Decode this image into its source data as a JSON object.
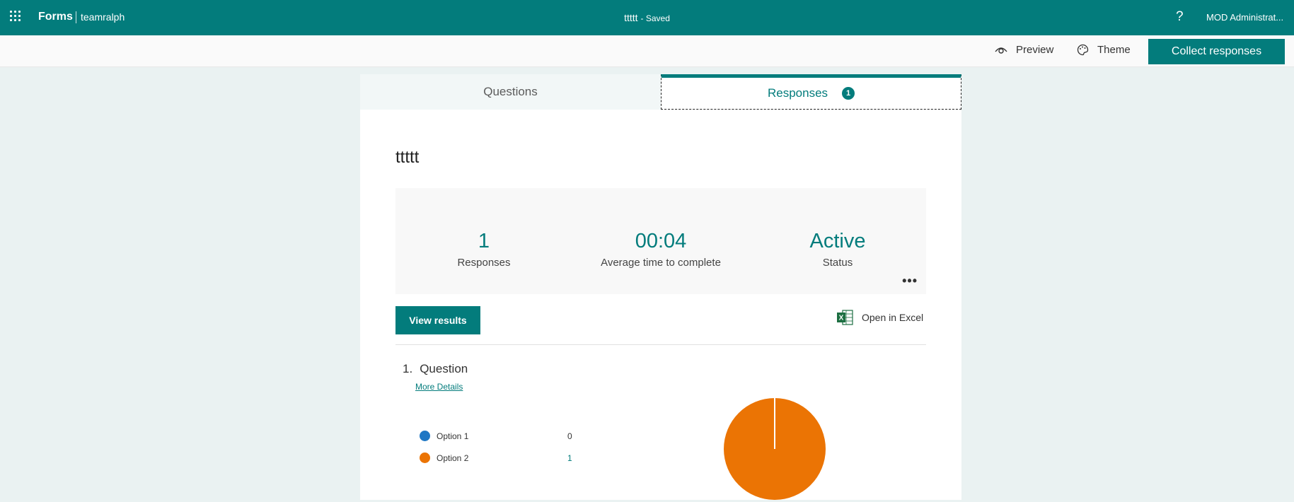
{
  "topbar": {
    "app_name": "Forms",
    "tenant": "teamralph",
    "doc_title": "ttttt",
    "save_status": "- Saved",
    "help": "?",
    "user": "MOD Administrat..."
  },
  "commandbar": {
    "preview_label": "Preview",
    "theme_label": "Theme",
    "collect_label": "Collect responses"
  },
  "tabs": {
    "questions_label": "Questions",
    "responses_label": "Responses",
    "responses_count": "1"
  },
  "form": {
    "title": "ttttt",
    "stats": [
      {
        "value": "1",
        "label": "Responses"
      },
      {
        "value": "00:04",
        "label": "Average time to complete"
      },
      {
        "value": "Active",
        "label": "Status"
      }
    ],
    "more": "•••",
    "view_results_label": "View results",
    "open_excel_label": "Open in Excel"
  },
  "question": {
    "number": "1.",
    "title": "Question",
    "more_details": "More Details",
    "colors": {
      "option1": "#1f77c4",
      "option2": "#eb7404",
      "teal": "#037c7c"
    }
  },
  "chart_data": {
    "type": "pie",
    "categories": [
      "Option 1",
      "Option 2"
    ],
    "values": [
      0,
      1
    ]
  }
}
